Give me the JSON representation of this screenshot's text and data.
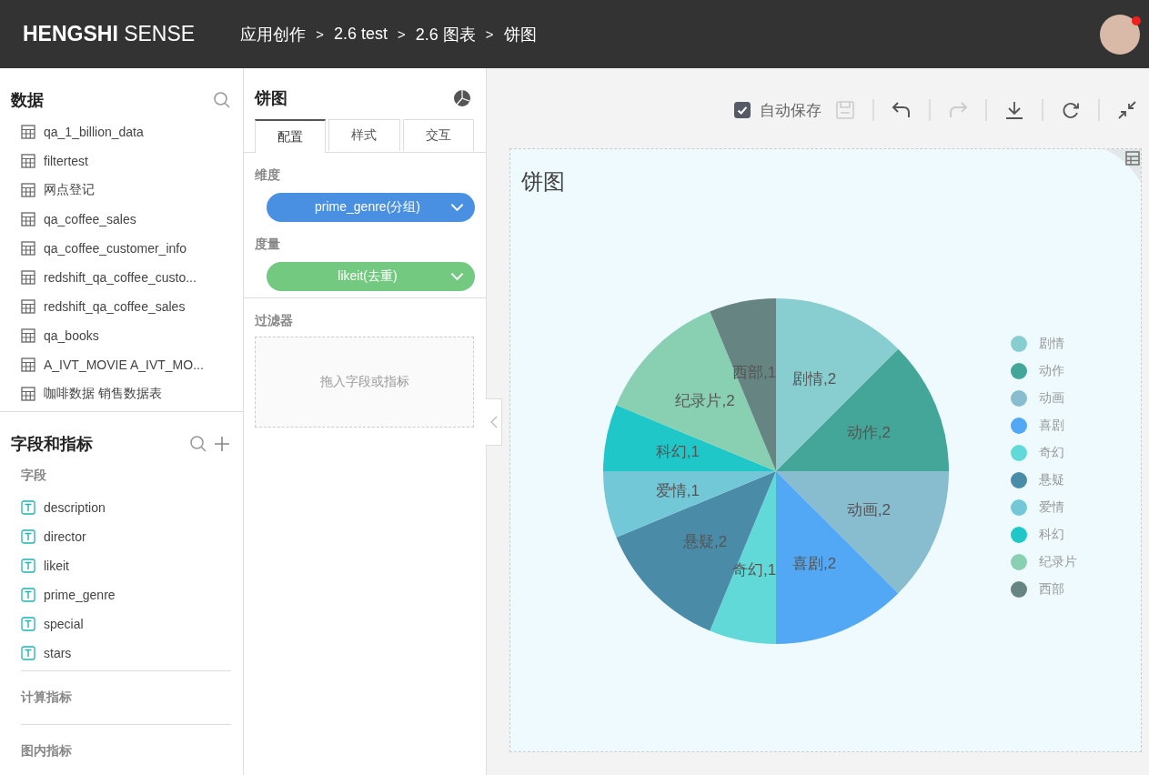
{
  "header": {
    "logo_bold": "HENGSHI",
    "logo_light": "SENSE",
    "breadcrumb": [
      {
        "kind": "crumb",
        "text": "应用创作"
      },
      {
        "kind": "separator",
        "text": ">"
      },
      {
        "kind": "crumb",
        "text": "2.6 test"
      },
      {
        "kind": "separator",
        "text": ">"
      },
      {
        "kind": "crumb",
        "text": "2.6 图表"
      },
      {
        "kind": "separator",
        "text": ">"
      },
      {
        "kind": "crumb",
        "text": "饼图"
      }
    ],
    "notification": true
  },
  "data_panel": {
    "title": "数据",
    "tables": [
      "qa_1_billion_data",
      "filtertest",
      "网点登记",
      "qa_coffee_sales",
      "qa_coffee_customer_info",
      "redshift_qa_coffee_custo...",
      "redshift_qa_coffee_sales",
      "qa_books",
      "A_IVT_MOVIE A_IVT_MO...",
      "咖啡数据 销售数据表"
    ]
  },
  "fields_panel": {
    "title": "字段和指标",
    "fields_heading": "字段",
    "fields": [
      "description",
      "director",
      "likeit",
      "prime_genre",
      "special",
      "stars"
    ],
    "sections": [
      "计算指标",
      "图内指标"
    ]
  },
  "config_panel": {
    "title": "饼图",
    "tabs": [
      {
        "label": "配置",
        "selected": true
      },
      {
        "label": "样式",
        "selected": false
      },
      {
        "label": "交互",
        "selected": false
      }
    ],
    "slots": [
      {
        "kind": "dimension",
        "label": "维度",
        "field": "prime_genre(分组)"
      },
      {
        "kind": "measure",
        "label": "度量",
        "field": "likeit(去重)"
      }
    ],
    "filter": {
      "label": "过滤器",
      "placeholder": "拖入字段或指标"
    }
  },
  "toolbar": {
    "autosave": {
      "label": "自动保存",
      "checked": true
    },
    "buttons": [
      {
        "kind": "save",
        "disabled": true
      },
      {
        "kind": "undo",
        "disabled": false
      },
      {
        "kind": "redo",
        "disabled": true
      },
      {
        "kind": "download",
        "disabled": false
      },
      {
        "kind": "refresh",
        "disabled": false
      },
      {
        "kind": "collapse",
        "disabled": false
      }
    ]
  },
  "chart_card": {
    "title": "饼图",
    "chart_data": {
      "type": "pie",
      "categories": [
        "剧情",
        "动作",
        "动画",
        "喜剧",
        "奇幻",
        "悬疑",
        "爱情",
        "科幻",
        "纪录片",
        "西部"
      ],
      "values": [
        2,
        2,
        2,
        2,
        1,
        2,
        1,
        1,
        2,
        1
      ],
      "value_labels": [
        "剧情,2",
        "动作,2",
        "动画,2",
        "喜剧,2",
        "奇幻,1",
        "悬疑,2",
        "爱情,1",
        "科幻,1",
        "纪录片,2",
        "西部,1"
      ]
    },
    "legend": [
      {
        "color": "#88cdd0"
      },
      {
        "color": "#43a698"
      },
      {
        "color": "#88bdcf"
      },
      {
        "color": "#52a8f5"
      },
      {
        "color": "#62d9d9"
      },
      {
        "color": "#4a8ba8"
      },
      {
        "color": "#73c8d8"
      },
      {
        "color": "#20c7c8"
      },
      {
        "color": "#88d0b1"
      },
      {
        "color": "#668582"
      }
    ]
  }
}
